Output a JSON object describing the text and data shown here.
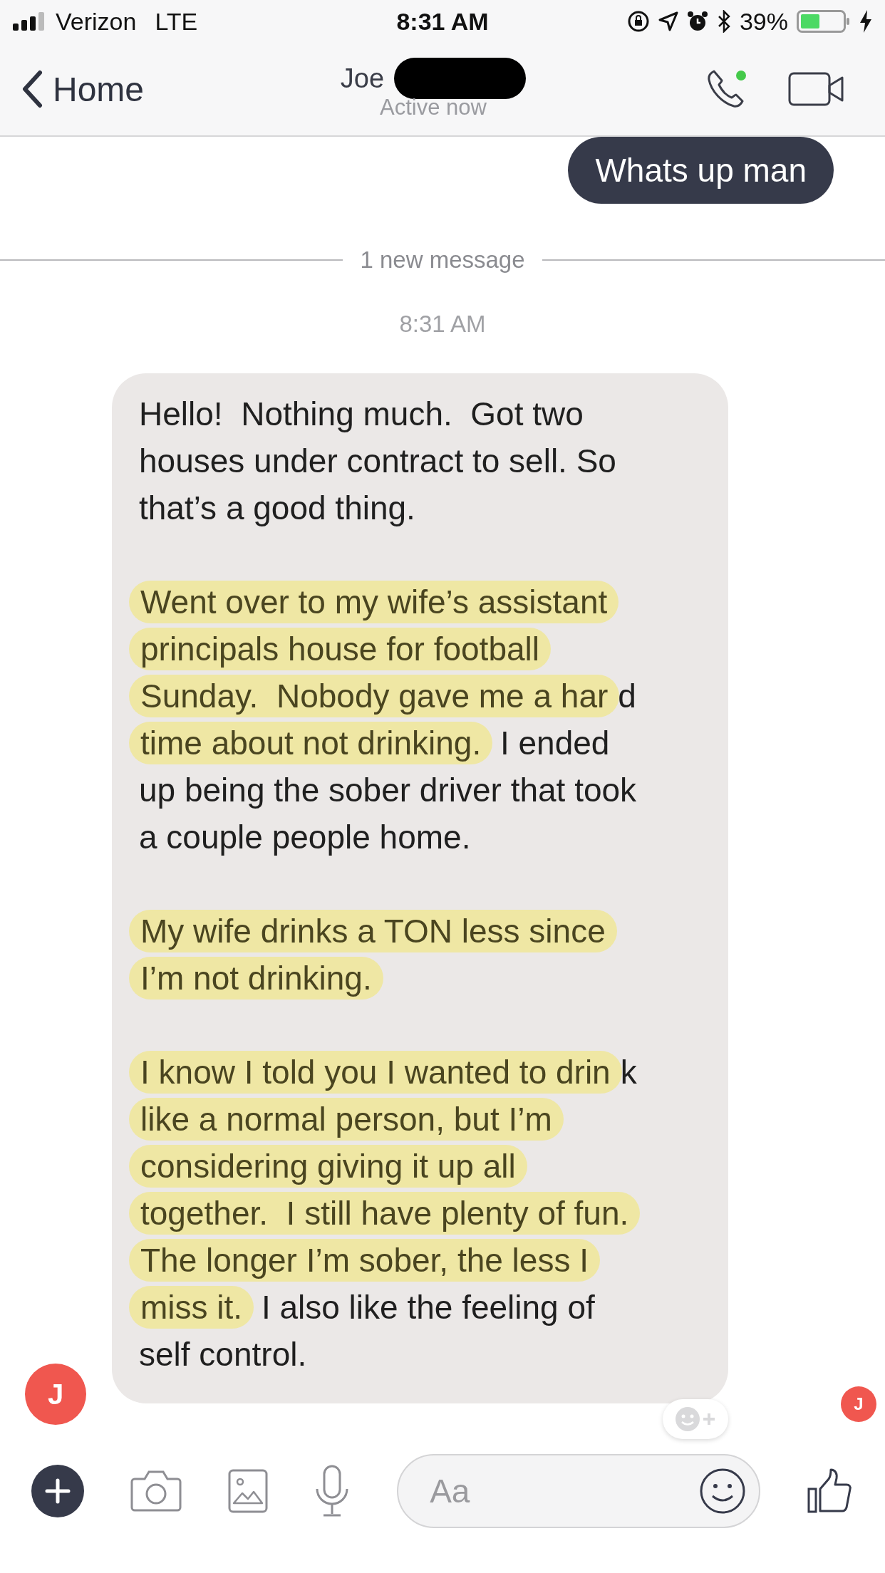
{
  "status_bar": {
    "carrier": "Verizon",
    "network": "LTE",
    "time": "8:31 AM",
    "battery": "39%"
  },
  "header": {
    "back_label": "Home",
    "contact_name": "Joe",
    "status": "Active now"
  },
  "outgoing": {
    "text": "Whats up man"
  },
  "divider": {
    "label": "1 new message"
  },
  "timestamp": "8:31 AM",
  "incoming": {
    "avatar_initial": "J",
    "read_initial": "J",
    "paragraphs": [
      [
        [
          {
            "text": "Hello!  Nothing much.  Got two",
            "highlighted": false
          }
        ],
        [
          {
            "text": "houses under contract to sell. So",
            "highlighted": false
          }
        ],
        [
          {
            "text": "that’s a good thing.",
            "highlighted": false
          }
        ]
      ],
      [
        [
          {
            "text": "Went over to my wife’s assistant",
            "highlighted": true
          }
        ],
        [
          {
            "text": "principals house for football",
            "highlighted": true
          }
        ],
        [
          {
            "text": "Sunday.  Nobody gave me a har",
            "highlighted": true
          },
          {
            "text": "d",
            "highlighted": false
          }
        ],
        [
          {
            "text": "time about not drinking.",
            "highlighted": true
          },
          {
            "text": " I ended",
            "highlighted": false
          }
        ],
        [
          {
            "text": "up being the sober driver that took",
            "highlighted": false
          }
        ],
        [
          {
            "text": "a couple people home.",
            "highlighted": false
          }
        ]
      ],
      [
        [
          {
            "text": "My wife drinks a TON less since",
            "highlighted": true
          }
        ],
        [
          {
            "text": "I’m not drinking.",
            "highlighted": true
          }
        ]
      ],
      [
        [
          {
            "text": "I know I told you I wanted to drin",
            "highlighted": true
          },
          {
            "text": "k",
            "highlighted": false
          }
        ],
        [
          {
            "text": "like a normal person, but I’m",
            "highlighted": true
          }
        ],
        [
          {
            "text": "considering giving it up all",
            "highlighted": true
          }
        ],
        [
          {
            "text": "together.  I still have plenty of fun.",
            "highlighted": true
          }
        ],
        [
          {
            "text": "The longer I’m sober, the less I",
            "highlighted": true
          }
        ],
        [
          {
            "text": "miss it.",
            "highlighted": true
          },
          {
            "text": " I also like the feeling of",
            "highlighted": false
          }
        ],
        [
          {
            "text": "self control.",
            "highlighted": false
          }
        ]
      ]
    ]
  },
  "composer": {
    "placeholder": "Aa"
  }
}
